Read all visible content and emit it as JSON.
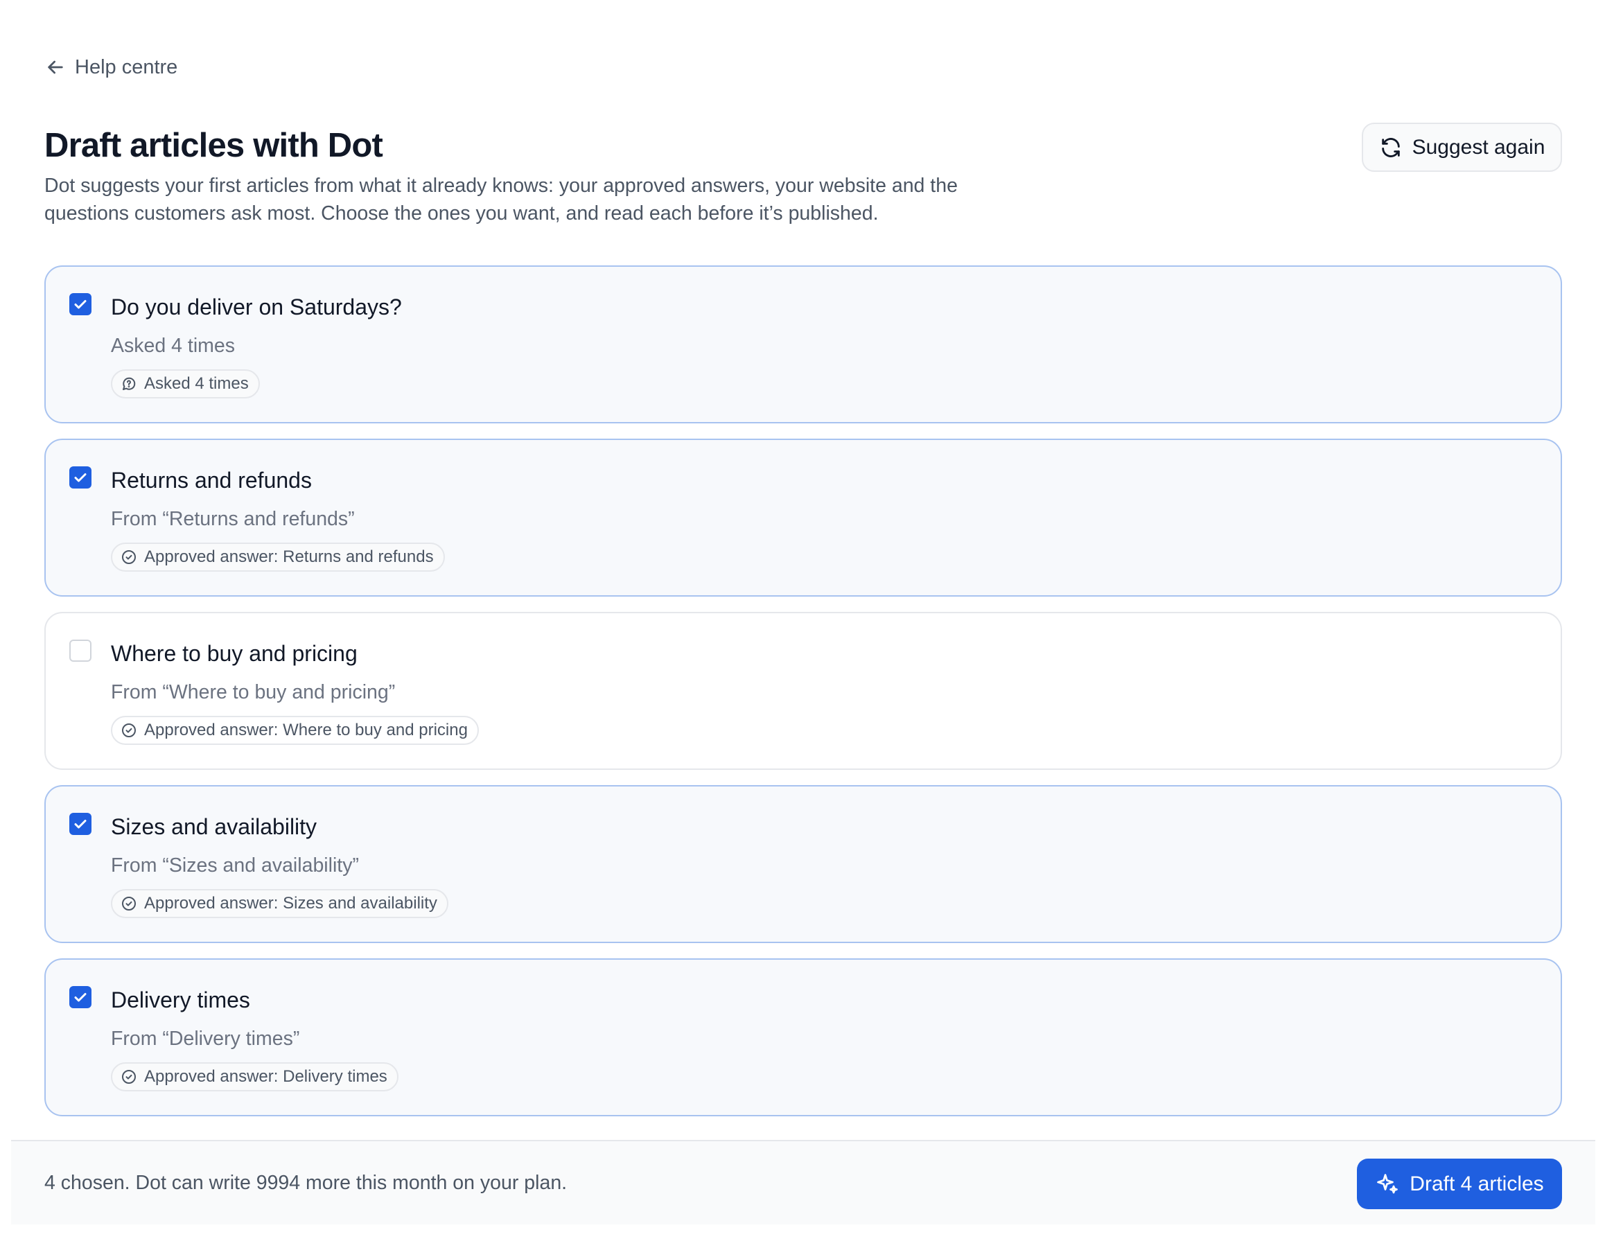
{
  "nav": {
    "back_label": "Help centre"
  },
  "header": {
    "title": "Draft articles with Dot",
    "description": "Dot suggests your first articles from what it already knows: your approved answers, your website and the questions customers ask most. Choose the ones you want, and read each before it’s published.",
    "suggest_again_label": "Suggest again"
  },
  "suggestions": [
    {
      "title": "Do you deliver on Saturdays?",
      "subtitle": "Asked 4 times",
      "tag": "Asked 4 times",
      "tag_icon": "question-bubble-icon",
      "checked": true
    },
    {
      "title": "Returns and refunds",
      "subtitle": "From “Returns and refunds”",
      "tag": "Approved answer: Returns and refunds",
      "tag_icon": "check-circle-icon",
      "checked": true
    },
    {
      "title": "Where to buy and pricing",
      "subtitle": "From “Where to buy and pricing”",
      "tag": "Approved answer: Where to buy and pricing",
      "tag_icon": "check-circle-icon",
      "checked": false
    },
    {
      "title": "Sizes and availability",
      "subtitle": "From “Sizes and availability”",
      "tag": "Approved answer: Sizes and availability",
      "tag_icon": "check-circle-icon",
      "checked": true
    },
    {
      "title": "Delivery times",
      "subtitle": "From “Delivery times”",
      "tag": "Approved answer: Delivery times",
      "tag_icon": "check-circle-icon",
      "checked": true
    }
  ],
  "footer": {
    "status_text": "4 chosen. Dot can write 9994 more this month on your plan.",
    "draft_button_label": "Draft 4 articles"
  },
  "colors": {
    "accent": "#1f5fe0",
    "checked_border": "#a8c3f0",
    "checked_bg": "#f7f9fc"
  }
}
